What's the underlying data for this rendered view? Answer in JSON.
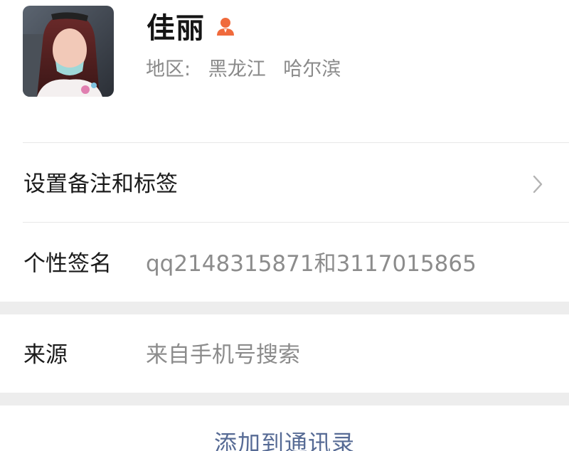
{
  "profile": {
    "name": "佳丽",
    "gender_icon": "female-user-icon",
    "gender_color": "#f06a3c",
    "region_label": "地区:",
    "region_province": "黑龙江",
    "region_city": "哈尔滨"
  },
  "rows": {
    "remark": {
      "label": "设置备注和标签",
      "icon": "chevron-right-icon"
    },
    "signature": {
      "label": "个性签名",
      "value": "qq2148315871和3117015865"
    },
    "source": {
      "label": "来源",
      "value": "来自手机号搜索"
    }
  },
  "actions": {
    "add_contact": "添加到通讯录"
  },
  "colors": {
    "link": "#576b95",
    "separator_band": "#ededed",
    "secondary_text": "#8c8c8c"
  }
}
